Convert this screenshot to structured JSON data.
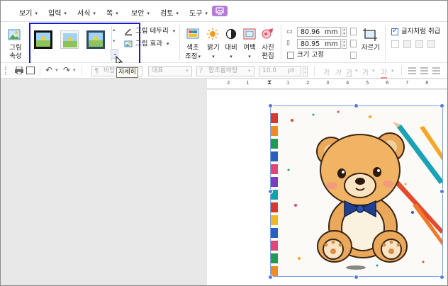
{
  "menu": [
    {
      "label": "보기"
    },
    {
      "label": "입력"
    },
    {
      "label": "서식"
    },
    {
      "label": "쪽"
    },
    {
      "label": "보안"
    },
    {
      "label": "검토"
    },
    {
      "label": "도구"
    }
  ],
  "ribbon": {
    "picture_props_label": "그림\n속성",
    "picture_props_line1": "그림",
    "picture_props_line2": "속성",
    "border_label": "그림 테두리",
    "effect_label": "그림 효과",
    "color_adjust_line1": "색조",
    "color_adjust_line2": "조정",
    "brightness_label": "밝기",
    "contrast_label": "대비",
    "margin_label": "여백",
    "photo_edit_line1": "사진",
    "photo_edit_line2": "편집",
    "width_value": "80.96",
    "height_value": "80.95",
    "unit": "mm",
    "fix_size_label": "크기 고정",
    "crop_label": "자르기",
    "text_wrap_label": "글자처럼 취급",
    "accent_color": "#1818d6"
  },
  "format_bar": {
    "style_field": "바탕글",
    "lang_field": "대표",
    "font_field": "함초롬바탕",
    "size_value": "10.0",
    "size_unit": "pt"
  },
  "tooltip": "자세히",
  "ruler_numbers": [
    "2",
    "1",
    "1",
    "2",
    "3",
    "4",
    "5",
    "6",
    "7",
    "8"
  ]
}
